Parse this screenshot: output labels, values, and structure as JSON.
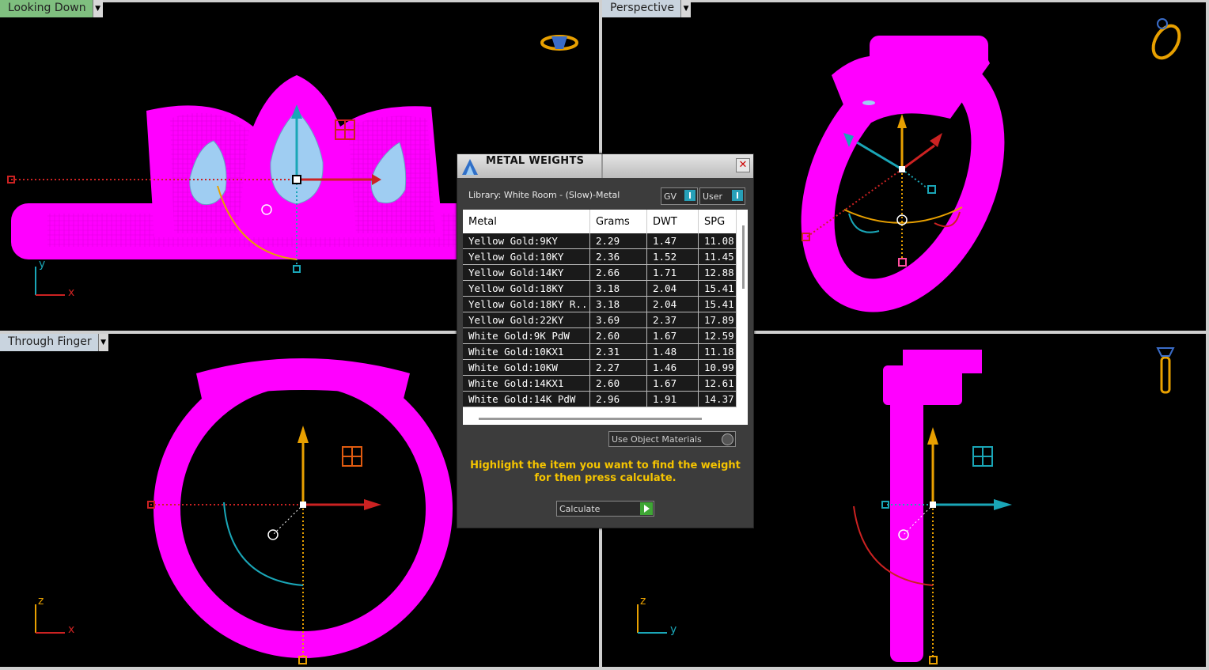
{
  "viewports": {
    "top_left": {
      "label": "Looking Down"
    },
    "top_right": {
      "label": "Perspective"
    },
    "bottom_left": {
      "label": "Through Finger"
    },
    "bottom_right": {
      "label": ""
    }
  },
  "axes": {
    "top_left": {
      "vertical": "y",
      "horizontal": "x"
    },
    "bottom_left": {
      "vertical": "z",
      "horizontal": "x"
    },
    "bottom_right": {
      "vertical": "z",
      "horizontal": "y"
    }
  },
  "colors": {
    "model": "#ff00ff",
    "gem": "#9fcdf2",
    "axis_x": "#cc2222",
    "axis_y": "#e8a000",
    "axis_z": "#1aa6b7",
    "message": "#f5c400"
  },
  "dialog": {
    "title": "METAL WEIGHTS",
    "library": "Library: White Room - (Slow)-Metal",
    "toggle_gv": "GV",
    "toggle_user": "User",
    "columns": [
      "Metal",
      "Grams",
      "DWT",
      "SPG"
    ],
    "rows": [
      [
        "Yellow Gold:9KY",
        "2.29",
        "1.47",
        "11.08"
      ],
      [
        "Yellow Gold:10KY",
        "2.36",
        "1.52",
        "11.45"
      ],
      [
        "Yellow Gold:14KY",
        "2.66",
        "1.71",
        "12.88"
      ],
      [
        "Yellow Gold:18KY",
        "3.18",
        "2.04",
        "15.41"
      ],
      [
        "Yellow Gold:18KY R...",
        "3.18",
        "2.04",
        "15.41"
      ],
      [
        "Yellow Gold:22KY",
        "3.69",
        "2.37",
        "17.89"
      ],
      [
        "White Gold:9K PdW",
        "2.60",
        "1.67",
        "12.59"
      ],
      [
        "White Gold:10KX1",
        "2.31",
        "1.48",
        "11.18"
      ],
      [
        "White Gold:10KW",
        "2.27",
        "1.46",
        "10.99"
      ],
      [
        "White Gold:14KX1",
        "2.60",
        "1.67",
        "12.61"
      ],
      [
        "White Gold:14K PdW",
        "2.96",
        "1.91",
        "14.37"
      ]
    ],
    "use_object_materials": "Use Object Materials",
    "message": "Highlight the item you want to find the weight for then press calculate.",
    "calculate": "Calculate"
  }
}
